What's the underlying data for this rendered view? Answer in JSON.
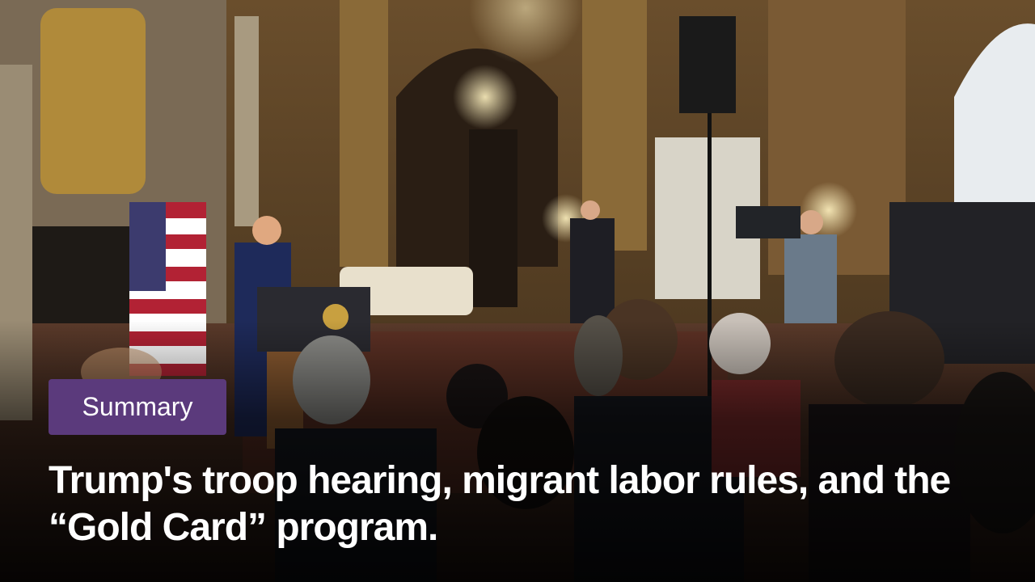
{
  "badge": {
    "label": "Summary",
    "color": "#5b3a7c"
  },
  "headline": {
    "text": "Trump's troop hearing, migrant labor rules, and the “Gold Card” program."
  },
  "scene": {
    "description_icons": [
      "press-room-photo"
    ]
  }
}
